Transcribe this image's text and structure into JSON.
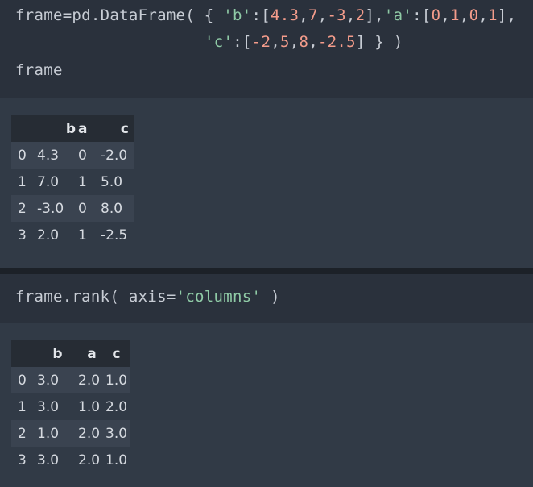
{
  "cell1": {
    "line1": {
      "prefix": "frame=pd.DataFrame( { ",
      "key_b": "'b'",
      "sep_b": ":[",
      "nums_b": [
        "4.3",
        "7",
        "-3",
        "2"
      ],
      "close_b": "],",
      "key_a": "'a'",
      "sep_a": ":[",
      "nums_a": [
        "0",
        "1",
        "0",
        "1"
      ],
      "close_a": "],"
    },
    "line2": {
      "key_c": "'c'",
      "sep_c": ":[",
      "nums_c": [
        "-2",
        "5",
        "8",
        "-2.5"
      ],
      "close_c": "] } )"
    },
    "line3": "frame"
  },
  "output1": {
    "columns": [
      "",
      "b",
      "a",
      "c"
    ],
    "rows": [
      [
        "0",
        "4.3",
        "0",
        "-2.0"
      ],
      [
        "1",
        "7.0",
        "1",
        "5.0"
      ],
      [
        "2",
        "-3.0",
        "0",
        "8.0"
      ],
      [
        "3",
        "2.0",
        "1",
        "-2.5"
      ]
    ]
  },
  "cell2": {
    "prefix": "frame.rank( axis",
    "eq": "=",
    "arg": "'columns'",
    "suffix": " )"
  },
  "output2": {
    "columns": [
      "",
      "b",
      "a",
      "c"
    ],
    "rows": [
      [
        "0",
        "3.0",
        "2.0",
        "1.0"
      ],
      [
        "1",
        "3.0",
        "1.0",
        "2.0"
      ],
      [
        "2",
        "1.0",
        "2.0",
        "3.0"
      ],
      [
        "3",
        "3.0",
        "2.0",
        "1.0"
      ]
    ]
  }
}
